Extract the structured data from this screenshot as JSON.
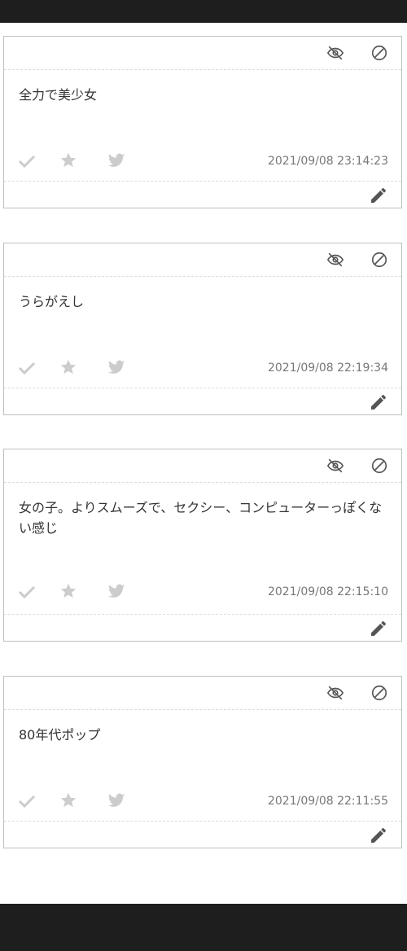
{
  "icons": {
    "hide": "eye-slash-icon",
    "block": "ban-icon",
    "check": "check-icon",
    "star": "star-icon",
    "twitter": "twitter-bird-icon",
    "edit": "pencil-icon"
  },
  "colors": {
    "bar": "#1e1e1e",
    "icon_dark": "#555555",
    "icon_light": "#cccccc",
    "timestamp": "#777777"
  },
  "posts": [
    {
      "text": "全力で美少女",
      "timestamp": "2021/09/08 23:14:23"
    },
    {
      "text": "うらがえし",
      "timestamp": "2021/09/08 22:19:34"
    },
    {
      "text": "女の子。よりスムーズで、セクシー、コンピューターっぽくない感じ",
      "timestamp": "2021/09/08 22:15:10"
    },
    {
      "text": "80年代ポップ",
      "timestamp": "2021/09/08 22:11:55"
    }
  ]
}
